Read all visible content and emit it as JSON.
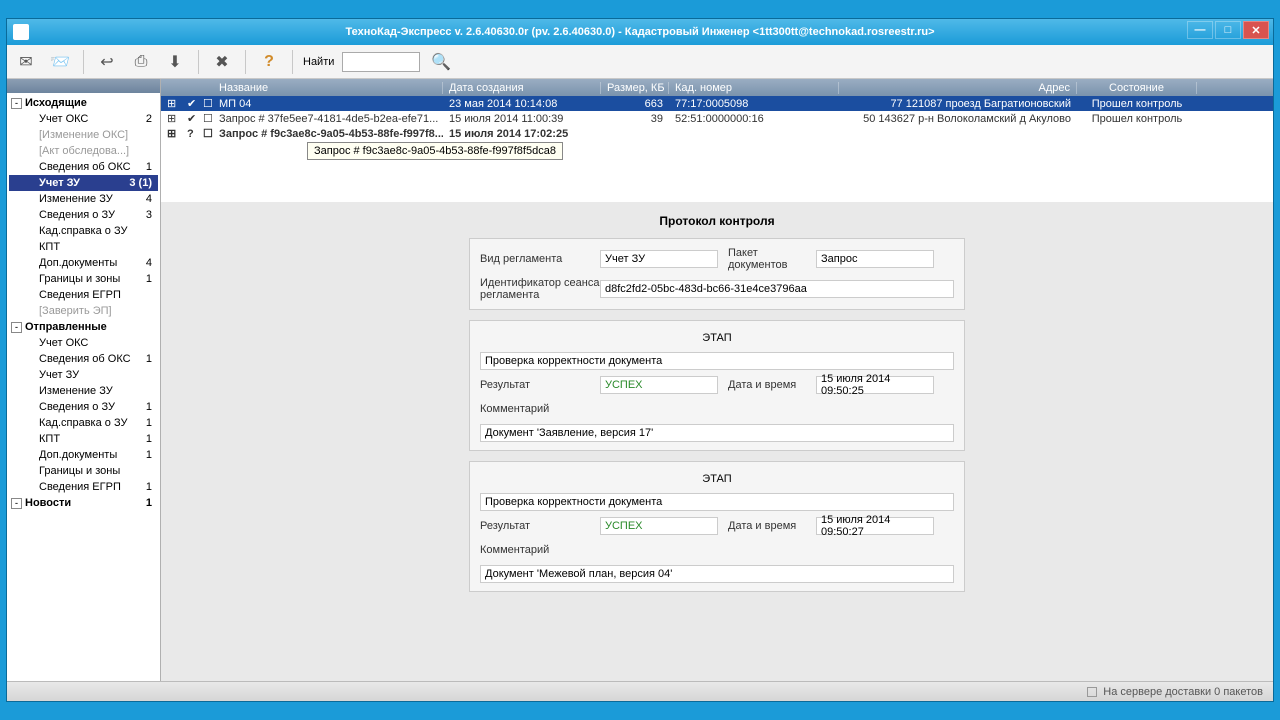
{
  "title": "ТехноКад-Экспресс v. 2.6.40630.0r (pv. 2.6.40630.0) - Кадастровый Инженер <1tt300tt@technokad.rosreestr.ru>",
  "toolbar": {
    "find": "Найти"
  },
  "sidebar": {
    "items": [
      {
        "label": "Исходящие",
        "bold": true,
        "lvl": 0,
        "tog": "-"
      },
      {
        "label": "Учет ОКС",
        "cnt": "2",
        "lvl": 1
      },
      {
        "label": "[Изменение ОКС]",
        "dim": true,
        "lvl": 1
      },
      {
        "label": "[Акт обследова...]",
        "dim": true,
        "lvl": 1
      },
      {
        "label": "Сведения об ОКС",
        "cnt": "1",
        "lvl": 1
      },
      {
        "label": "Учет ЗУ",
        "cnt": "3 (1)",
        "lvl": 1,
        "sel": true,
        "bold": true
      },
      {
        "label": "Изменение ЗУ",
        "cnt": "4",
        "lvl": 1
      },
      {
        "label": "Сведения о ЗУ",
        "cnt": "3",
        "lvl": 1
      },
      {
        "label": "Кад.справка о ЗУ",
        "lvl": 1
      },
      {
        "label": "КПТ",
        "lvl": 1
      },
      {
        "label": "Доп.документы",
        "cnt": "4",
        "lvl": 1
      },
      {
        "label": "Границы и зоны",
        "cnt": "1",
        "lvl": 1
      },
      {
        "label": "Сведения ЕГРП",
        "lvl": 1
      },
      {
        "label": "[Заверить ЭП]",
        "dim": true,
        "lvl": 1
      },
      {
        "label": "Отправленные",
        "bold": true,
        "lvl": 0,
        "tog": "-"
      },
      {
        "label": "Учет ОКС",
        "lvl": 1
      },
      {
        "label": "Сведения об ОКС",
        "cnt": "1",
        "lvl": 1
      },
      {
        "label": "Учет ЗУ",
        "lvl": 1
      },
      {
        "label": "Изменение ЗУ",
        "lvl": 1
      },
      {
        "label": "Сведения о ЗУ",
        "cnt": "1",
        "lvl": 1
      },
      {
        "label": "Кад.справка о ЗУ",
        "cnt": "1",
        "lvl": 1
      },
      {
        "label": "КПТ",
        "cnt": "1",
        "lvl": 1
      },
      {
        "label": "Доп.документы",
        "cnt": "1",
        "lvl": 1
      },
      {
        "label": "Границы и зоны",
        "lvl": 1
      },
      {
        "label": "Сведения ЕГРП",
        "cnt": "1",
        "lvl": 1
      },
      {
        "label": "Новости",
        "cnt": "1",
        "bold": true,
        "lvl": 0,
        "tog": "-"
      }
    ]
  },
  "columns": [
    "Название",
    "Дата создания",
    "Размер, КБ",
    "Кад. номер",
    "Адрес",
    "Состояние"
  ],
  "rows": [
    {
      "st": "✔",
      "name": "МП 04",
      "date": "23 мая 2014 10:14:08",
      "size": "663",
      "num": "77:17:0005098",
      "addr": "77 121087 проезд Багратионовский",
      "state": "Прошел контроль",
      "sel": true
    },
    {
      "st": "✔",
      "name": "Запрос # 37fe5ee7-4181-4de5-b2ea-efe71...",
      "date": "15 июля 2014 11:00:39",
      "size": "39",
      "num": "52:51:0000000:16",
      "addr": "50 143627 р-н Волоколамский д Акулово",
      "state": "Прошел контроль"
    },
    {
      "st": "?",
      "name": "Запрос # f9c3ae8c-9a05-4b53-88fe-f997f8...",
      "date": "15 июля 2014 17:02:25",
      "size": "",
      "num": "",
      "addr": "",
      "state": "",
      "b": true
    }
  ],
  "tooltip": "Запрос # f9c3ae8c-9a05-4b53-88fe-f997f8f5dca8",
  "protocol": {
    "title": "Протокол контроля",
    "regType": {
      "label": "Вид регламента",
      "value": "Учет ЗУ"
    },
    "pack": {
      "label": "Пакет документов",
      "value": "Запрос"
    },
    "sess": {
      "label": "Идентификатор сеанса регламента",
      "value": "d8fc2fd2-05bc-483d-bc66-31e4ce3796aa"
    },
    "stageLabel": "ЭТАП",
    "stages": [
      {
        "check": "Проверка корректности документа",
        "resLabel": "Результат",
        "res": "УСПЕХ",
        "dtLabel": "Дата и время",
        "dt": "15 июля 2014 09:50:25",
        "comLabel": "Комментарий",
        "com": "Документ 'Заявление, версия 17'"
      },
      {
        "check": "Проверка корректности документа",
        "resLabel": "Результат",
        "res": "УСПЕХ",
        "dtLabel": "Дата и время",
        "dt": "15 июля 2014 09:50:27",
        "comLabel": "Комментарий",
        "com": "Документ 'Межевой план, версия 04'"
      }
    ]
  },
  "status": "На сервере доставки 0 пакетов"
}
